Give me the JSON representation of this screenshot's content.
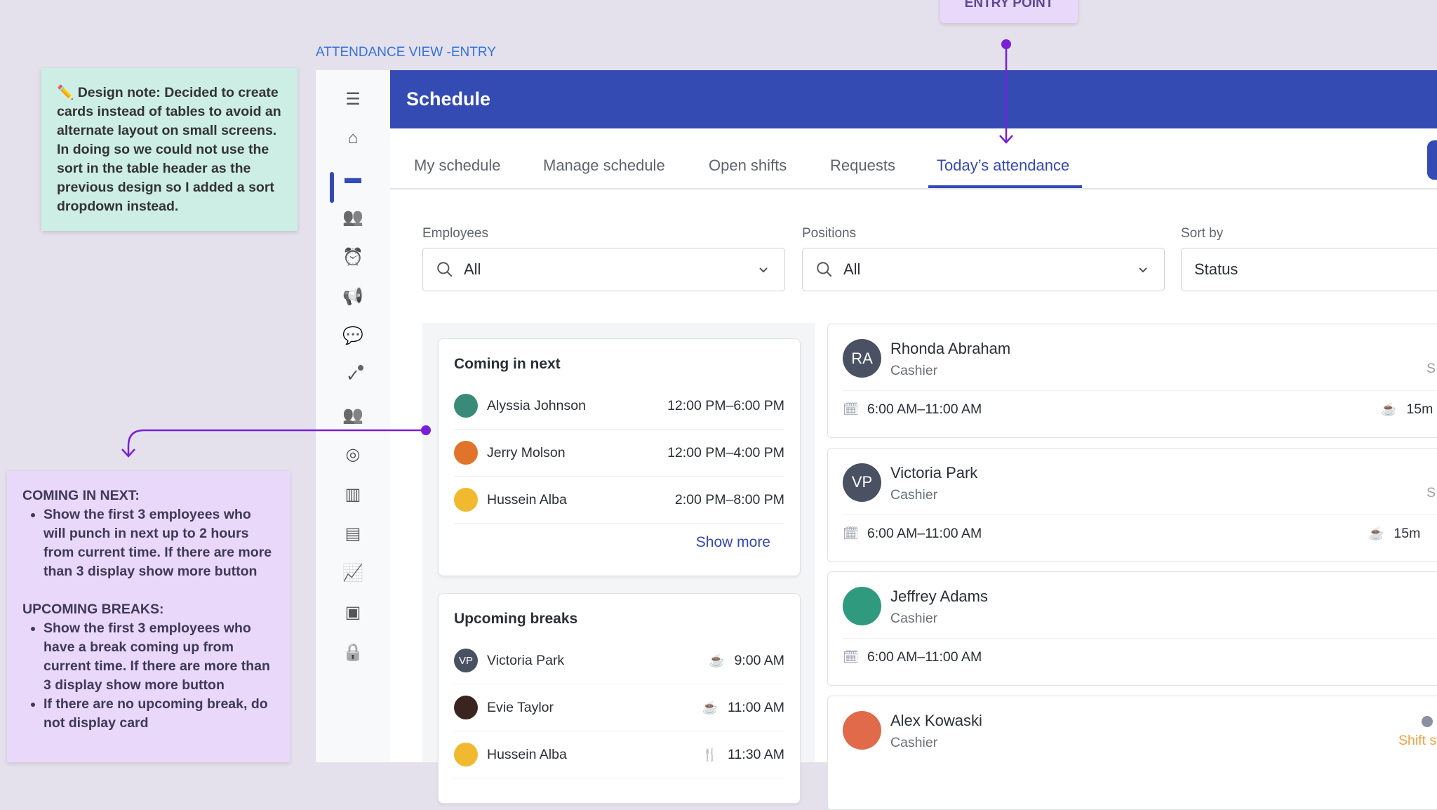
{
  "annotations": {
    "design_note": "✏️ Design note: Decided to create cards instead of tables to avoid an alternate layout on small screens. In doing so we could not use the sort in the table header as the previous design so I added a sort dropdown instead.",
    "entry_point": "ENTRY POINT",
    "frame_label": "ATTENDANCE VIEW -ENTRY",
    "coming_title": "COMING IN NEXT:",
    "coming_bullets": [
      "Show the first 3 employees who will punch in next up to 2 hours from current time. If there are more than 3 display show more button"
    ],
    "breaks_title": "UPCOMING BREAKS:",
    "breaks_bullets": [
      "Show the first 3 employees who have a break coming up from current time. If there are more than 3 display show more button",
      "If there are no upcoming break, do not display card"
    ]
  },
  "colors": {
    "primary": "#344bb3",
    "annotation_arrow": "#7a1fd8",
    "warning": "#f0a040",
    "notification": "#e0453a"
  },
  "sidebar": {
    "icons": [
      "menu-icon",
      "home-icon",
      "calendar-icon",
      "team-check-icon",
      "alarm-clock-icon",
      "megaphone-icon",
      "chat-icon",
      "task-check-icon",
      "people-icon",
      "target-icon",
      "library-icon",
      "news-icon",
      "chart-icon",
      "payroll-icon",
      "lock-icon"
    ],
    "active": "calendar-icon"
  },
  "header": {
    "title": "Schedule"
  },
  "tabs": [
    {
      "label": "My schedule"
    },
    {
      "label": "Manage schedule"
    },
    {
      "label": "Open shifts"
    },
    {
      "label": "Requests"
    },
    {
      "label": "Today’s attendance",
      "active": true
    }
  ],
  "filters": {
    "employees": {
      "label": "Employees",
      "value": "All"
    },
    "positions": {
      "label": "Positions",
      "value": "All"
    },
    "sort": {
      "label": "Sort by",
      "value": "Status"
    }
  },
  "coming_next": {
    "title": "Coming in next",
    "rows": [
      {
        "name": "Alyssia Johnson",
        "time": "12:00 PM–6:00 PM",
        "color": "#3a8a7a"
      },
      {
        "name": "Jerry Molson",
        "time": "12:00 PM–4:00 PM",
        "color": "#e0742a"
      },
      {
        "name": "Hussein Alba",
        "time": "2:00 PM–8:00 PM",
        "color": "#f0b930"
      }
    ],
    "show_more": "Show more"
  },
  "upcoming_breaks": {
    "title": "Upcoming breaks",
    "rows": [
      {
        "name": "Victoria Park",
        "initials": "VP",
        "time": "9:00 AM",
        "icon": "coffee-icon",
        "color": "#4a5163"
      },
      {
        "name": "Evie Taylor",
        "initials": "",
        "time": "11:00 AM",
        "icon": "coffee-icon",
        "color": "#3a2420"
      },
      {
        "name": "Hussein Alba",
        "initials": "",
        "time": "11:30 AM",
        "icon": "meal-icon",
        "color": "#f0b930"
      }
    ]
  },
  "employees": [
    {
      "name": "Rhonda Abraham",
      "initials": "RA",
      "role": "Cashier",
      "shift": "6:00 AM–11:00 AM",
      "break": "15m",
      "side": "S",
      "color": "#4a5163"
    },
    {
      "name": "Victoria Park",
      "initials": "VP",
      "role": "Cashier",
      "shift": "6:00 AM–11:00 AM",
      "break": "15m",
      "side": "S",
      "color": "#4a5163"
    },
    {
      "name": "Jeffrey Adams",
      "initials": "",
      "role": "Cashier",
      "shift": "6:00 AM–11:00 AM",
      "break": "",
      "side": "",
      "color": "#2f9a7e"
    },
    {
      "name": "Alex Kowaski",
      "initials": "",
      "role": "Cashier",
      "shift": "",
      "break": "",
      "side": "Shift st",
      "color": "#e06a4a"
    }
  ]
}
